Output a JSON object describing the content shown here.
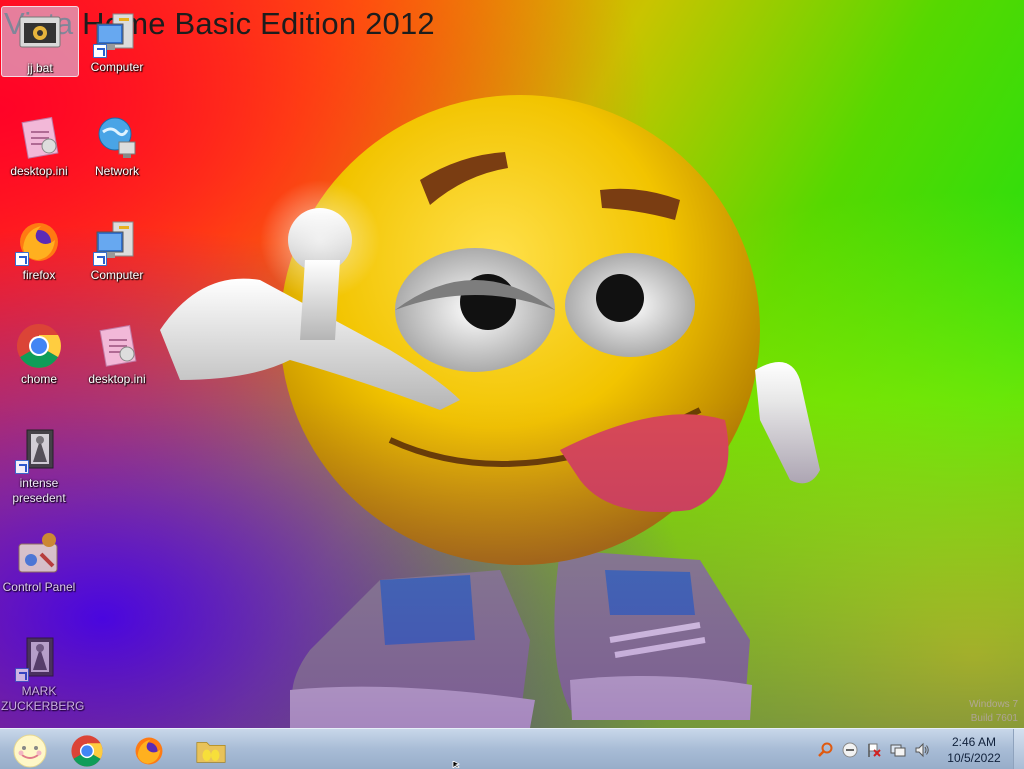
{
  "wallpaper": {
    "title": "Vista Home Basic Edition 2012",
    "watermark_line1": "Windows 7",
    "watermark_line2": "Build 7601"
  },
  "desktop_icons": [
    {
      "label": "jj.bat",
      "icon": "batch-file-icon",
      "selected": true
    },
    {
      "label": "Computer",
      "icon": "computer-icon"
    },
    {
      "label": "desktop.ini",
      "icon": "settings-file-icon"
    },
    {
      "label": "Network",
      "icon": "network-globe-icon"
    },
    {
      "label": "firefox",
      "icon": "firefox-icon"
    },
    {
      "label": "Computer",
      "icon": "computer-icon"
    },
    {
      "label": "chome",
      "icon": "chrome-icon"
    },
    {
      "label": "desktop.ini",
      "icon": "settings-file-icon"
    },
    {
      "label": "intense presedent",
      "icon": "media-shortcut-icon"
    },
    {
      "label": "Control Panel",
      "icon": "control-panel-icon"
    },
    {
      "label": "MARK ZUCKERBERG",
      "icon": "media-shortcut-icon"
    }
  ],
  "taskbar": {
    "start_icon": "smiley-start-orb-icon",
    "pinned": [
      {
        "name": "chrome",
        "icon": "chrome-icon"
      },
      {
        "name": "firefox",
        "icon": "firefox-icon"
      },
      {
        "name": "folder",
        "icon": "folder-icon"
      }
    ],
    "tray": [
      "search-icon",
      "network-status-icon",
      "action-center-flag-icon",
      "display-icon",
      "volume-icon"
    ],
    "clock_time": "2:46 AM",
    "clock_date": "10/5/2022"
  },
  "colors": {
    "taskbar_top": "#c8d7ea",
    "taskbar_bottom": "#97adc9",
    "emoji_yellow": "#f2c400",
    "tongue": "#d94a55"
  }
}
